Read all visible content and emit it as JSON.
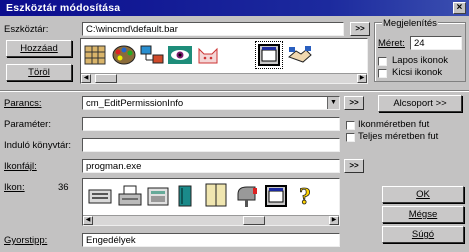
{
  "window": {
    "title": "Eszköztár módosítása",
    "close_glyph": "×"
  },
  "toolbar": {
    "label": "Eszköztár:",
    "path": "C:\\wincmd\\default.bar",
    "browse_label": ">>",
    "add_label": "Hozzáad",
    "delete_label": "Töröl",
    "icons": [
      "toolbar-grid-icon",
      "palette-icon",
      "network-icon",
      "eye-icon",
      "cat-icon",
      "window-icon",
      "handshake-icon"
    ]
  },
  "appearance": {
    "title": "Megjelenítés",
    "size_label": "Méret:",
    "size_value": "24",
    "flat_icons": "Lapos ikonok",
    "small_icons": "Kicsi ikonok"
  },
  "command": {
    "label": "Parancs:",
    "value": "cm_EditPermissionInfo",
    "browse_label": ">>",
    "group_label": "Alcsoport >>"
  },
  "parameter": {
    "label": "Paraméter:",
    "value": "",
    "iconsize_label": "Ikonméretben fut",
    "maximized_label": "Teljes méretben fut"
  },
  "startdir": {
    "label": "Induló könyvtár:",
    "value": ""
  },
  "iconfile": {
    "label": "Ikonfájl:",
    "value": "progman.exe",
    "browse_label": ">>"
  },
  "icons": {
    "label": "Ikon:",
    "count": "36",
    "items": [
      "keyboard-icon",
      "typewriter-icon",
      "calculator-icon",
      "book-icon",
      "doors-icon",
      "mailbox-icon",
      "window-icon",
      "question-icon"
    ]
  },
  "buttons": {
    "ok": "OK",
    "cancel": "Mégse",
    "help": "Súgó"
  },
  "tooltip": {
    "label": "Gyorstipp:",
    "value": "Engedélyek"
  }
}
